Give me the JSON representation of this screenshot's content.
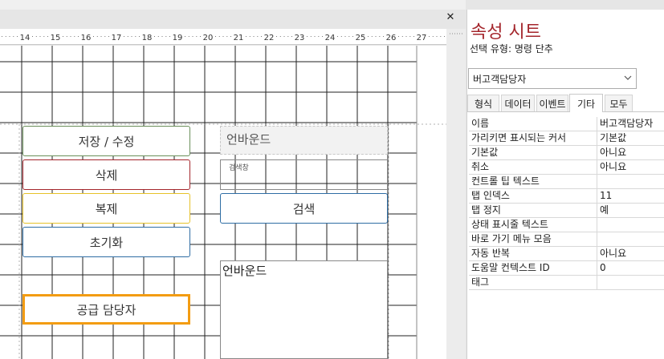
{
  "window": {
    "close_glyph": "✕"
  },
  "ruler": {
    "ticks": [
      "14",
      "15",
      "16",
      "17",
      "18",
      "19",
      "20",
      "21",
      "22",
      "23",
      "24",
      "25",
      "26",
      "27"
    ]
  },
  "form": {
    "buttons": [
      {
        "label": "저장 / 수정",
        "border_color": "#6a8f5a"
      },
      {
        "label": "삭제",
        "border_color": "#a4262c"
      },
      {
        "label": "복제",
        "border_color": "#e6c229"
      },
      {
        "label": "초기화",
        "border_color": "#2e6da4"
      },
      {
        "label": "공급 담당자",
        "border_color": "#f39c12",
        "selected": true
      }
    ],
    "unbound_label_top": "언바운드",
    "search_box_caption": "검색창",
    "search_button_label": "검색",
    "unbound_box_label": "언바운드"
  },
  "property_sheet": {
    "title": "속성 시트",
    "selection_type": "선택 유형: 명령 단추",
    "selected_object": "버고객담당자",
    "dropdown_icon": "chevron-down-icon",
    "tabs": [
      "형식",
      "데이터",
      "이벤트",
      "기타",
      "모두"
    ],
    "active_tab": "기타",
    "accent_color": "#a4262c",
    "rows": [
      {
        "key": "이름",
        "value": "버고객담당자"
      },
      {
        "key": "가리키면 표시되는 커서",
        "value": "기본값"
      },
      {
        "key": "기본값",
        "value": "아니요"
      },
      {
        "key": "취소",
        "value": "아니요"
      },
      {
        "key": "컨트롤 팁 텍스트",
        "value": ""
      },
      {
        "key": "탭 인덱스",
        "value": "11"
      },
      {
        "key": "탭 정지",
        "value": "예"
      },
      {
        "key": "상태 표시줄 텍스트",
        "value": ""
      },
      {
        "key": "바로 가기 메뉴 모음",
        "value": ""
      },
      {
        "key": "자동 반복",
        "value": "아니요"
      },
      {
        "key": "도움말 컨텍스트 ID",
        "value": "0"
      },
      {
        "key": "태그",
        "value": ""
      }
    ]
  }
}
